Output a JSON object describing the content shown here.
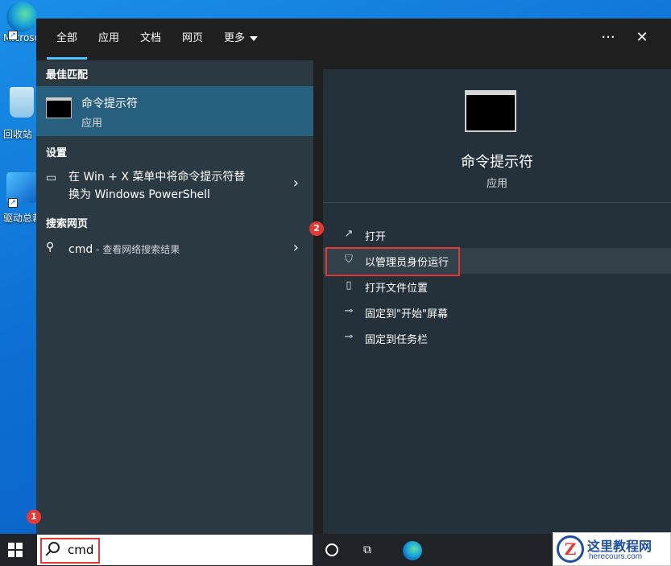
{
  "desktop": {
    "icons": [
      {
        "label": "Microsoft Edge",
        "icon": "edge-icon"
      },
      {
        "label": "回收站",
        "icon": "recycle-bin-icon"
      },
      {
        "label": "驱动总裁",
        "icon": "driver-app-icon"
      }
    ]
  },
  "tabs": [
    {
      "label": "全部"
    },
    {
      "label": "应用"
    },
    {
      "label": "文档"
    },
    {
      "label": "网页"
    },
    {
      "label": "更多"
    }
  ],
  "topbar": {
    "more_options": "···",
    "close": "✕"
  },
  "left": {
    "best_match_header": "最佳匹配",
    "best_match": {
      "title": "命令提示符",
      "subtitle": "应用"
    },
    "settings_header": "设置",
    "settings_item_line1": "在 Win + X 菜单中将命令提示符替",
    "settings_item_line2": "换为 Windows PowerShell",
    "web_header": "搜索网页",
    "web_query": "cmd",
    "web_suffix": " - 查看网络搜索结果",
    "chevron": "›"
  },
  "right": {
    "title": "命令提示符",
    "subtitle": "应用",
    "actions": [
      {
        "label": "打开",
        "icon": "open-icon"
      },
      {
        "label": "以管理员身份运行",
        "icon": "shield-icon"
      },
      {
        "label": "打开文件位置",
        "icon": "file-location-icon"
      },
      {
        "label": "固定到\"开始\"屏幕",
        "icon": "pin-icon"
      },
      {
        "label": "固定到任务栏",
        "icon": "pin-icon"
      }
    ]
  },
  "annotations": {
    "badge1": "1",
    "badge2": "2"
  },
  "taskbar": {
    "search_value": "cmd"
  },
  "watermark": {
    "title": "这里教程网",
    "url": "herecours.com",
    "logo": "Z"
  },
  "colors": {
    "accent": "#4cc2ff",
    "highlight_box": "#e53935",
    "best_match_bg": "#275f7f"
  }
}
